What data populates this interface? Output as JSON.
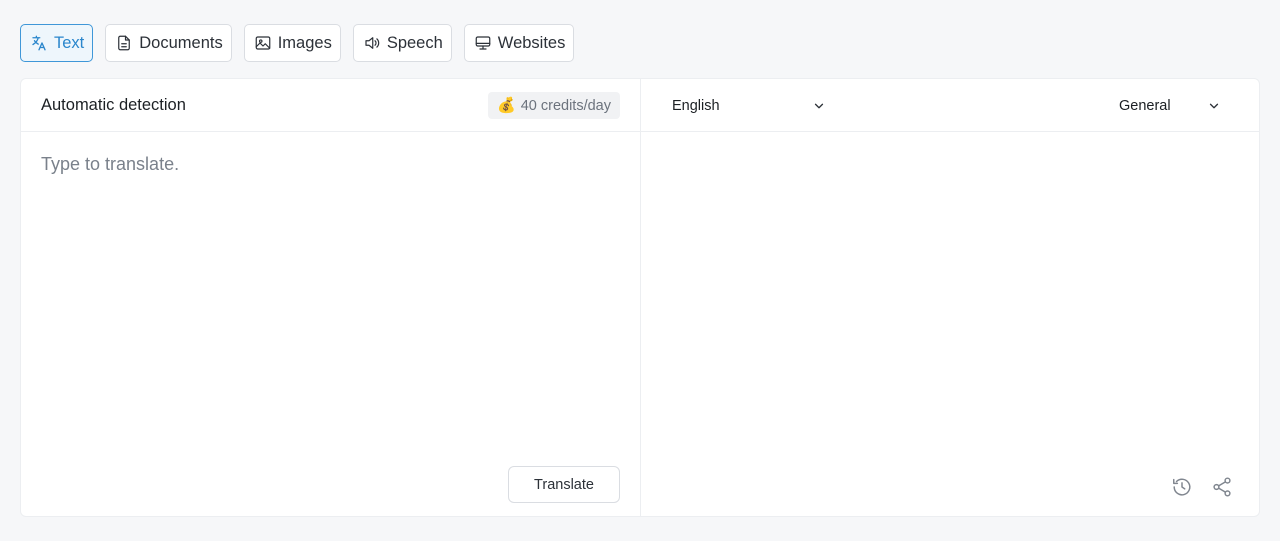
{
  "tabs": [
    {
      "label": "Text",
      "icon": "translate-icon",
      "active": true
    },
    {
      "label": "Documents",
      "icon": "document-icon",
      "active": false
    },
    {
      "label": "Images",
      "icon": "image-icon",
      "active": false
    },
    {
      "label": "Speech",
      "icon": "speaker-icon",
      "active": false
    },
    {
      "label": "Websites",
      "icon": "monitor-icon",
      "active": false
    }
  ],
  "source": {
    "language_label": "Automatic detection",
    "credits_label": "40 credits/day",
    "credits_icon": "money-bag-icon",
    "input_value": "",
    "input_placeholder": "Type to translate.",
    "translate_label": "Translate"
  },
  "target": {
    "language": "English",
    "domain": "General",
    "output": "",
    "actions": [
      "history-icon",
      "share-icon"
    ]
  },
  "colors": {
    "accent": "#2a86cc",
    "accent_border": "#3f97d8",
    "accent_bg": "#eef6fc",
    "page_bg": "#f6f7f9"
  }
}
